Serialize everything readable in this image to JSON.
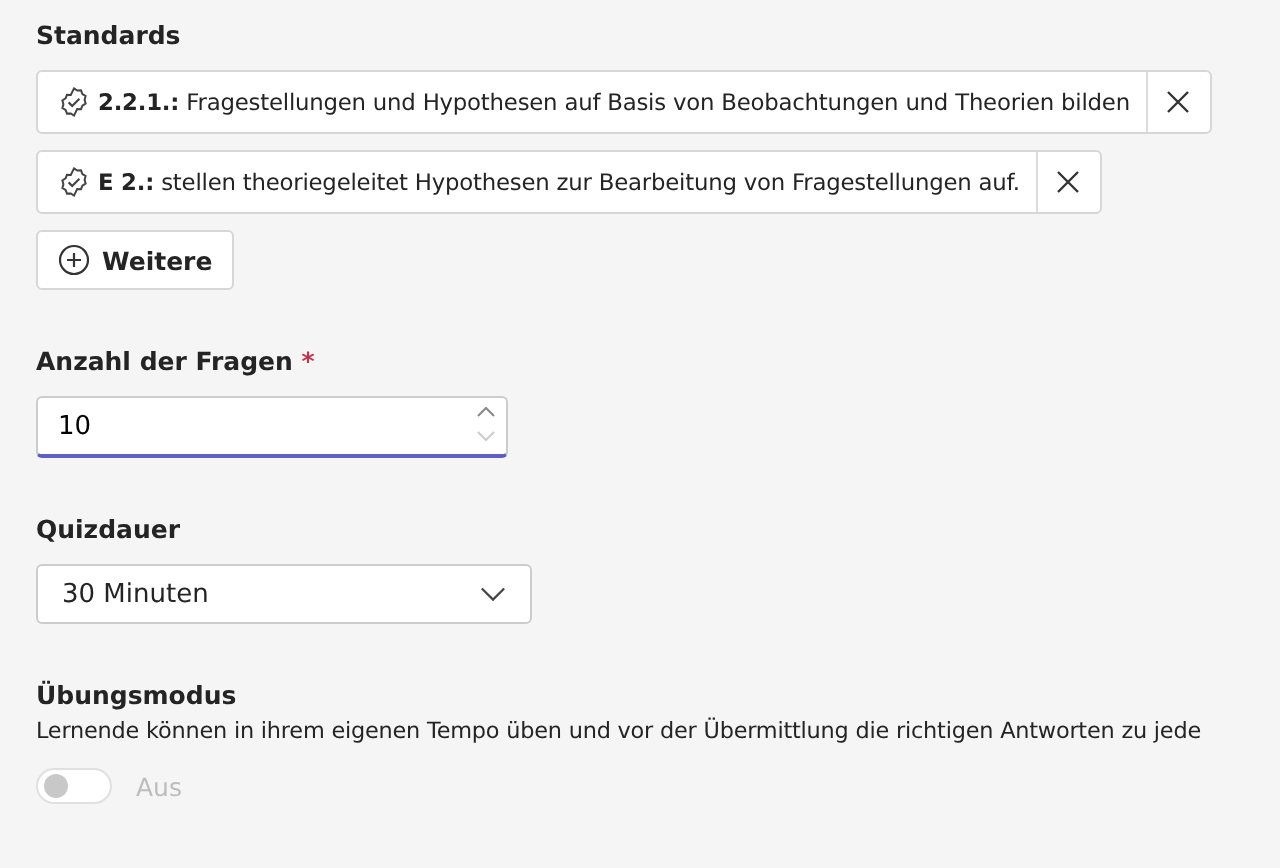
{
  "standards": {
    "label": "Standards",
    "items": [
      {
        "text": "**2.2.1.:** Fragestellungen und Hypothesen auf Basis von Beobachtungen und Theorien bilden"
      },
      {
        "text": "**E 2.:** stellen theoriegeleitet Hypothesen zur Bearbeitung von Fragestellungen auf."
      }
    ],
    "add_button": "Weitere"
  },
  "question_count": {
    "label": "Anzahl der Fragen",
    "required_mark": "*",
    "value": "10"
  },
  "duration": {
    "label": "Quizdauer",
    "value": "30 Minuten"
  },
  "practice_mode": {
    "label": "Übungsmodus",
    "description": "Lernende können in ihrem eigenen Tempo üben und vor der Übermittlung die richtigen Antworten zu jede",
    "toggle": {
      "on": false,
      "disabled": true,
      "label": "Aus"
    }
  }
}
